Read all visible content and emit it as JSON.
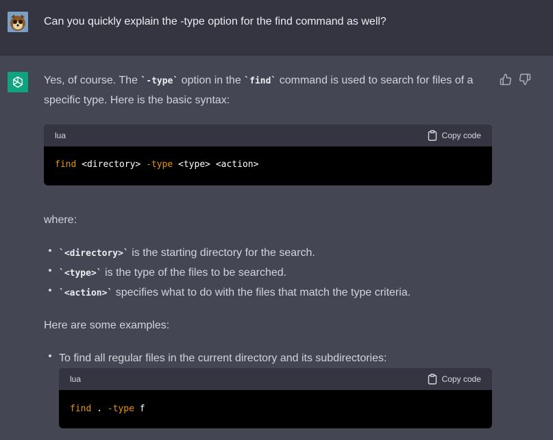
{
  "user": {
    "avatar_icon": "user-avatar-image",
    "message": "Can you quickly explain the -type option for the find command as well?"
  },
  "assistant": {
    "logo_icon": "openai-logo-icon",
    "intro": {
      "pre1": "Yes, of course. The ",
      "code1": "`-type`",
      "mid": " option in the ",
      "code2": "`find`",
      "post": " command is used to search for files of a specific type. Here is the basic syntax:"
    },
    "code_block_1": {
      "language": "lua",
      "copy_label": "Copy code",
      "tokens": {
        "t1": "find",
        "t2": " <directory> ",
        "t3": "-type",
        "t4": " <type> ",
        "t5": "<action>"
      }
    },
    "where_label": "where:",
    "bullets": [
      {
        "code": "`<directory>`",
        "text": " is the starting directory for the search."
      },
      {
        "code": "`<type>`",
        "text": " is the type of the files to be searched."
      },
      {
        "code": "`<action>`",
        "text": " specifies what to do with the files that match the type criteria."
      }
    ],
    "examples_label": "Here are some examples:",
    "example_1": {
      "text": "To find all regular files in the current directory and its subdirectories:",
      "language": "lua",
      "copy_label": "Copy code",
      "tokens": {
        "t1": "find",
        "t2": " . ",
        "t3": "-type",
        "t4": " f"
      }
    },
    "colors": {
      "background": "#444654",
      "user_background": "#343541",
      "code_background": "#000000",
      "keyword": "#e9950c",
      "accent": "#10a37f"
    }
  }
}
